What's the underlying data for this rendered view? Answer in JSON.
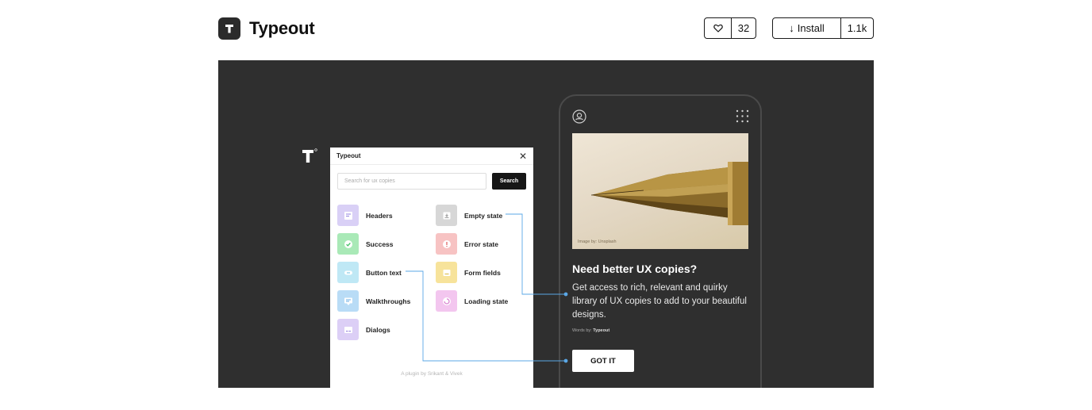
{
  "header": {
    "title": "Typeout",
    "logo_icon": "typeout-t-logo-icon",
    "like_icon": "heart-icon",
    "like_count": "32",
    "install_label": "Install",
    "install_icon": "arrow-down-icon",
    "install_count": "1.1k"
  },
  "cover": {
    "background": "#2f2f2f",
    "plugin": {
      "title": "Typeout",
      "search_placeholder": "Search for ux copies",
      "search_button": "Search",
      "categories": [
        {
          "label": "Headers",
          "color": "#d9d0f6"
        },
        {
          "label": "Success",
          "color": "#a9e9b7"
        },
        {
          "label": "Button text",
          "color": "#bfe8f5"
        },
        {
          "label": "Walkthroughs",
          "color": "#b9dcf6"
        },
        {
          "label": "Dialogs",
          "color": "#dccff6"
        },
        {
          "label": "Empty state",
          "color": "#d7d7d7"
        },
        {
          "label": "Error state",
          "color": "#f7c3c3"
        },
        {
          "label": "Form fields",
          "color": "#f7e39b"
        },
        {
          "label": "Loading state",
          "color": "#f3c6ef"
        }
      ],
      "footer": "A plugin by Srikant & Vivek"
    },
    "phone": {
      "photo_credit": "Image by: Unsplash",
      "heading": "Need better UX copies?",
      "body": "Get access to rich, relevant and quirky library of UX copies to add to your beautiful designs.",
      "words_by_label": "Words by:",
      "words_by_name": "Typeout",
      "cta": "GOT IT"
    },
    "connector_color": "#5aa7e6"
  }
}
